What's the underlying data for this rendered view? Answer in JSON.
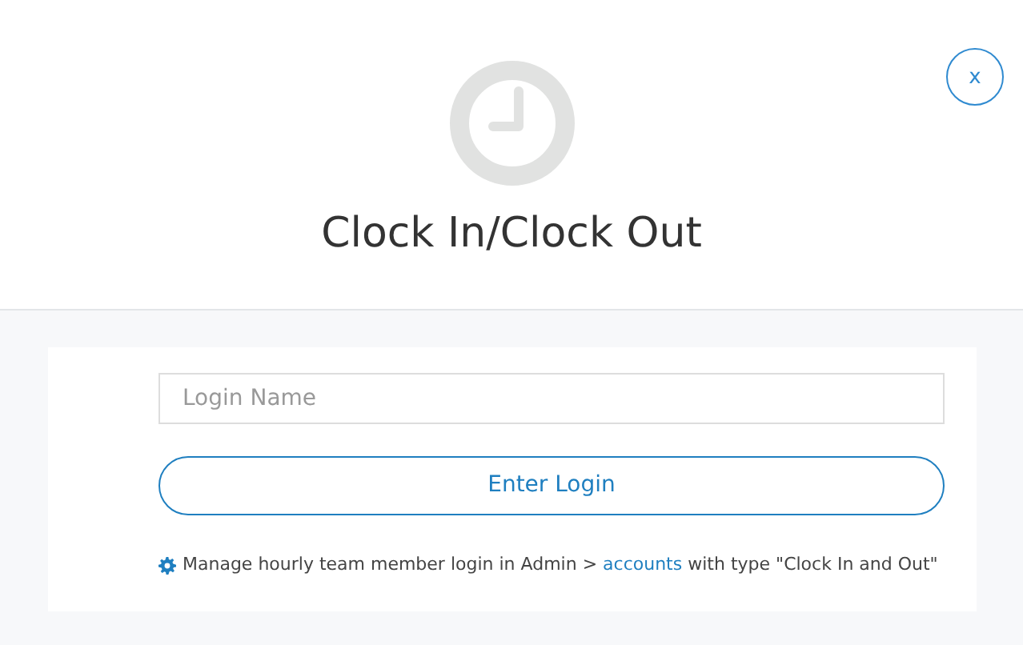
{
  "close_button": {
    "label": "x"
  },
  "title": "Clock In/Clock Out",
  "login_field": {
    "placeholder": "Login Name"
  },
  "enter_button": {
    "label": "Enter Login"
  },
  "note": {
    "before": "Manage hourly team member login in Admin > ",
    "link": "accounts",
    "after": " with type \"Clock In and Out\""
  }
}
